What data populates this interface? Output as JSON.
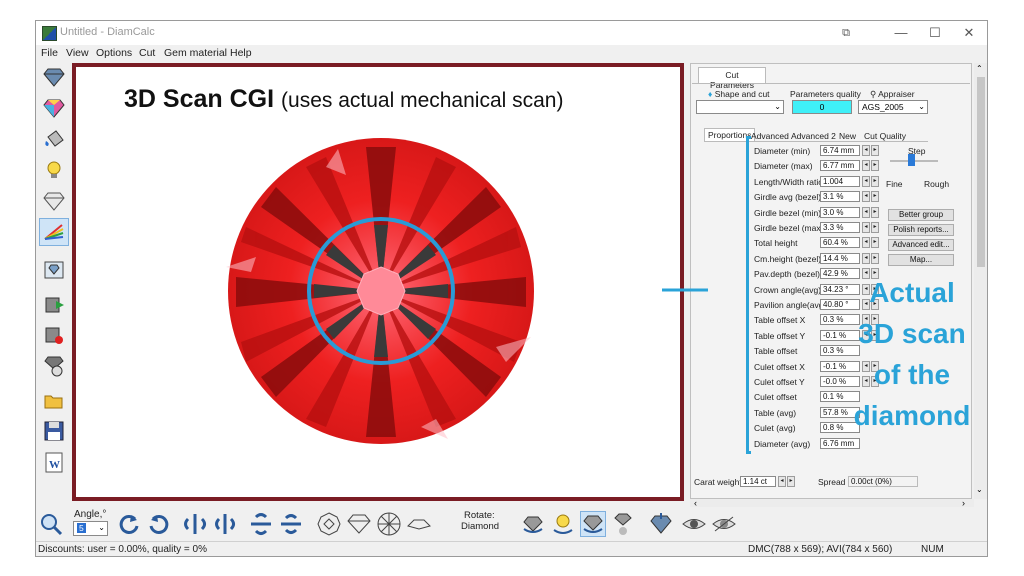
{
  "window": {
    "title": "Untitled - DiamCalc"
  },
  "menu": [
    "File",
    "View",
    "Options",
    "Cut",
    "Gem material",
    "Help"
  ],
  "viewport": {
    "title_bold": "3D Scan CGI",
    "title_rest": "(uses actual mechanical scan)"
  },
  "panel": {
    "tab_cut_parameters": "Cut Parameters",
    "shape_and_cut_label": "Shape and cut",
    "parameters_quality_label": "Parameters quality",
    "parameters_quality_value": "0",
    "appraiser_label": "Appraiser",
    "appraiser_value": "AGS_2005",
    "subtabs": [
      "Proportions",
      "Advanced",
      "Advanced 2",
      "New",
      "Cut Quality"
    ],
    "step_label": "Step",
    "fine_label": "Fine",
    "rough_label": "Rough",
    "params": [
      {
        "label": "Diameter (min)",
        "value": "6.74 mm"
      },
      {
        "label": "Diameter (max)",
        "value": "6.77 mm"
      },
      {
        "label": "Length/Width ratio",
        "value": "1.004"
      },
      {
        "label": "Girdle avg (bezel)",
        "value": "3.1 %"
      },
      {
        "label": "Girdle bezel (min)",
        "value": "3.0 %"
      },
      {
        "label": "Girdle bezel (max)",
        "value": "3.3 %"
      },
      {
        "label": "Total height",
        "value": "60.4 %"
      },
      {
        "label": "Cm.height (bezel)",
        "value": "14.4 %"
      },
      {
        "label": "Pav.depth (bezel)",
        "value": "42.9 %"
      },
      {
        "label": "Crown angle(avg)",
        "value": "34.23 °"
      },
      {
        "label": "Pavilion angle(avg)",
        "value": "40.80 °"
      },
      {
        "label": "Table offset X",
        "value": "0.3 %"
      },
      {
        "label": "Table offset Y",
        "value": "-0.1 %"
      },
      {
        "label": "Table offset",
        "value": "0.3 %"
      },
      {
        "label": "Culet offset X",
        "value": "-0.1 %"
      },
      {
        "label": "Culet offset Y",
        "value": "-0.0 %"
      },
      {
        "label": "Culet offset",
        "value": "0.1 %"
      },
      {
        "label": "Table (avg)",
        "value": "57.8 %"
      },
      {
        "label": "Culet (avg)",
        "value": "0.8 %"
      },
      {
        "label": "Diameter (avg)",
        "value": "6.76 mm"
      }
    ],
    "buttons": [
      "Better group",
      "Polish reports...",
      "Advanced edit...",
      "Map..."
    ],
    "carat_weight_label": "Carat weight",
    "carat_weight_value": "1.14 ct",
    "spread_label": "Spread",
    "spread_value": "0.00ct (0%)"
  },
  "annotation": {
    "lines": [
      "Actual",
      "3D scan",
      "of the",
      "diamond"
    ],
    "color": "#2aa3d8"
  },
  "toolbar": {
    "angle_label": "Angle,°",
    "angle_value": "5",
    "rotate_label": "Rotate:",
    "rotate_value": "Diamond"
  },
  "status": {
    "discounts": "Discounts: user = 0.00%, quality = 0%",
    "sizes": "DMC(788 x 569); AVI(784 x 560)",
    "num": "NUM"
  }
}
